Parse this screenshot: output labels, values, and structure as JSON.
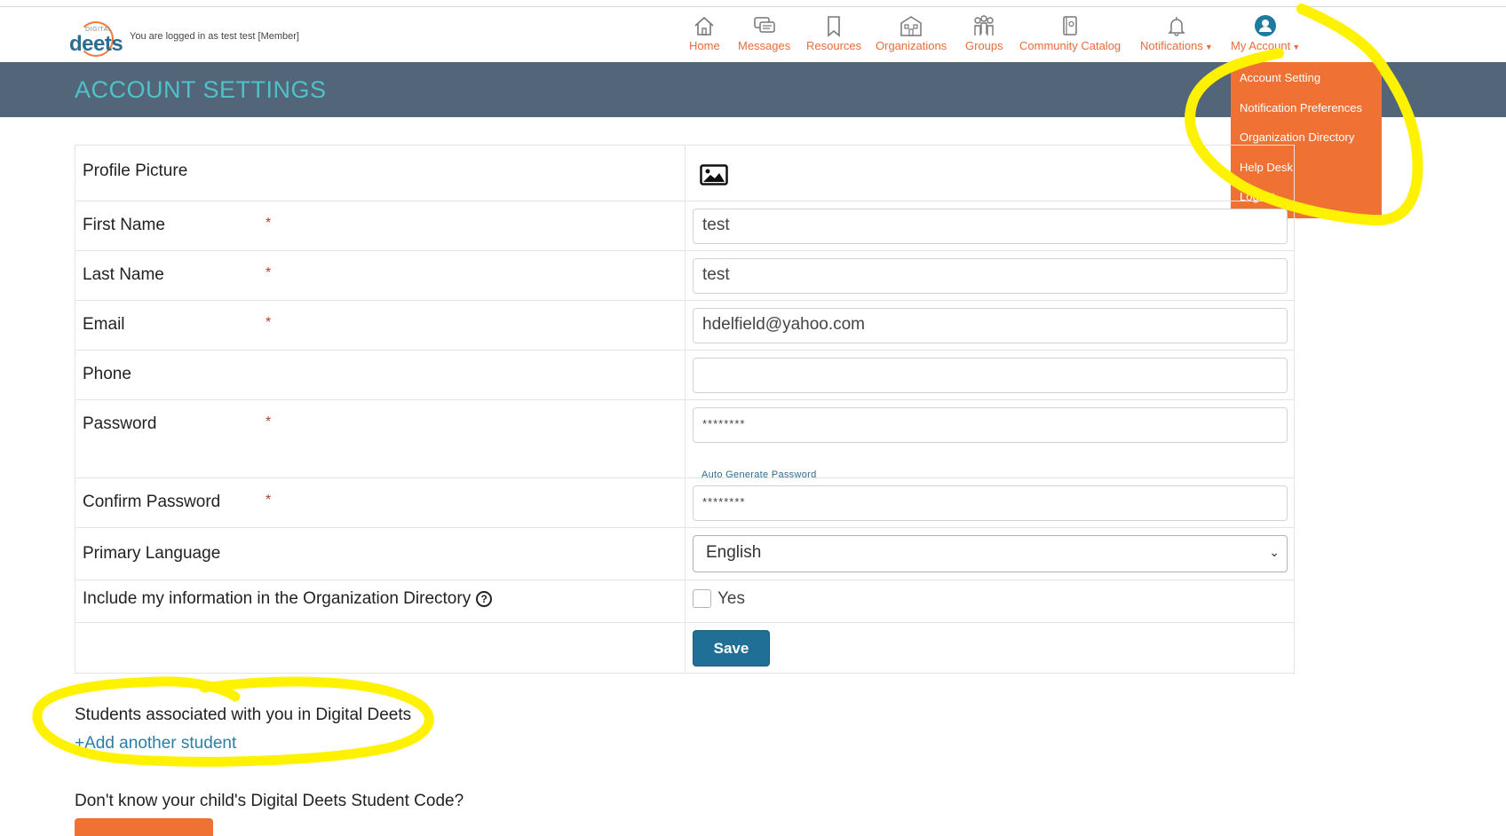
{
  "header": {
    "logo_small": "DIGITAL",
    "logo_word": "deets",
    "login_status": "You are logged in as test test [Member]"
  },
  "nav": [
    {
      "label": "Home",
      "icon": "home-icon"
    },
    {
      "label": "Messages",
      "icon": "messages-icon"
    },
    {
      "label": "Resources",
      "icon": "bookmark-icon"
    },
    {
      "label": "Organizations",
      "icon": "building-icon"
    },
    {
      "label": "Groups",
      "icon": "group-icon"
    },
    {
      "label": "Community Catalog",
      "icon": "catalog-icon"
    },
    {
      "label": "Notifications",
      "icon": "bell-icon"
    },
    {
      "label": "My Account",
      "icon": "user-icon"
    }
  ],
  "dropdown": {
    "items": [
      "Account Setting",
      "Notification Preferences",
      "Organization Directory",
      "Help Desk",
      "Logout"
    ]
  },
  "page": {
    "title": "ACCOUNT SETTINGS"
  },
  "form": {
    "required_mark": "*",
    "profile_picture_label": "Profile Picture",
    "first_name_label": "First Name",
    "first_name_value": "test",
    "last_name_label": "Last Name",
    "last_name_value": "test",
    "email_label": "Email",
    "email_value": "hdelfield@yahoo.com",
    "phone_label": "Phone",
    "phone_value": "",
    "password_label": "Password",
    "password_value": "********",
    "auto_generate": "Auto Generate Password",
    "confirm_password_label": "Confirm Password",
    "confirm_password_value": "********",
    "language_label": "Primary Language",
    "language_value": "English",
    "directory_label": "Include my information in the Organization Directory",
    "directory_checkbox_label": "Yes",
    "directory_checked": false,
    "save_label": "Save"
  },
  "students": {
    "title": "Students associated with you in Digital Deets",
    "add_link": "+Add another student",
    "code_question": "Don't know your child's Digital Deets Student Code?"
  },
  "colors": {
    "brand_orange": "#f07134",
    "banner": "#536578",
    "title_teal": "#4fc1c9",
    "save_blue": "#1f6f97",
    "annotation_yellow": "#fff200"
  }
}
